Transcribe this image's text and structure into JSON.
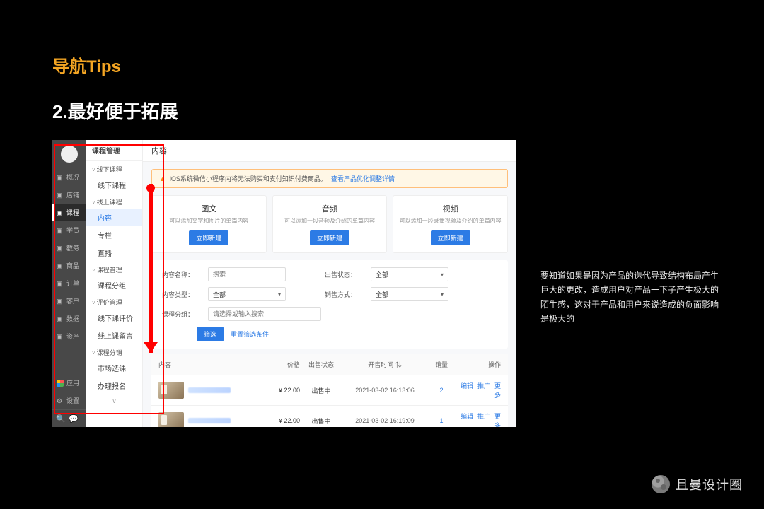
{
  "page": {
    "tips_label": "导航Tips",
    "heading": "2.最好便于拓展",
    "side_paragraph": "要知道如果是因为产品的迭代导致结构布局产生巨大的更改，造成用户对产品一下子产生极大的陌生感，这对于产品和用户来说造成的负面影响是极大的",
    "watermark": "且曼设计圈"
  },
  "rail": [
    {
      "icon": "overview",
      "label": "概况"
    },
    {
      "icon": "shop",
      "label": "店铺"
    },
    {
      "icon": "course",
      "label": "课程",
      "active": true
    },
    {
      "icon": "student",
      "label": "学员"
    },
    {
      "icon": "academic",
      "label": "教务"
    },
    {
      "icon": "goods",
      "label": "商品"
    },
    {
      "icon": "order",
      "label": "订单"
    },
    {
      "icon": "customer",
      "label": "客户"
    },
    {
      "icon": "data",
      "label": "数据"
    },
    {
      "icon": "asset",
      "label": "资产"
    }
  ],
  "rail_lower": [
    {
      "icon": "apps",
      "label": "应用"
    },
    {
      "icon": "settings",
      "label": "设置"
    }
  ],
  "subnav": {
    "title": "课程管理",
    "groups": [
      {
        "label": "线下课程",
        "items": [
          "线下课程"
        ]
      },
      {
        "label": "线上课程",
        "items": [
          "内容",
          "专栏",
          "直播"
        ],
        "active": "内容"
      },
      {
        "label": "课程管理",
        "items": [
          "课程分组"
        ]
      },
      {
        "label": "评价管理",
        "items": [
          "线下课评价",
          "线上课留言"
        ]
      },
      {
        "label": "课程分销",
        "items": [
          "市场选课"
        ]
      }
    ],
    "extra": "办理报名",
    "more": "∨"
  },
  "main": {
    "title": "内容",
    "alert": {
      "text": "iOS系统微信小程序内将无法购买和支付知识付费商品。",
      "link": "查看产品优化调整详情"
    },
    "cards": [
      {
        "title": "图文",
        "desc": "可以添加文字和图片的单篇内容",
        "btn": "立即新建"
      },
      {
        "title": "音频",
        "desc": "可以添加一段音频及介绍的单篇内容",
        "btn": "立即新建"
      },
      {
        "title": "视频",
        "desc": "可以添加一段录播视频及介绍的单篇内容",
        "btn": "立即新建"
      }
    ],
    "filters": {
      "name_label": "内容名称：",
      "name_placeholder": "搜索",
      "type_label": "内容类型：",
      "type_value": "全部",
      "status_label": "出售状态：",
      "status_value": "全部",
      "method_label": "销售方式：",
      "method_value": "全部",
      "group_label": "课程分组：",
      "group_placeholder": "请选择或输入搜索",
      "filter_btn": "筛选",
      "reset_link": "重置筛选条件"
    },
    "table": {
      "headers": {
        "content": "内容",
        "price": "价格",
        "status": "出售状态",
        "time": "开售时间 ⇅",
        "sales": "销量",
        "actions": "操作"
      },
      "rows": [
        {
          "price": "¥ 22.00",
          "status": "出售中",
          "time": "2021-03-02 16:13:06",
          "sales": "2"
        },
        {
          "price": "¥ 22.00",
          "status": "出售中",
          "time": "2021-03-02 16:19:09",
          "sales": "1"
        }
      ],
      "action_labels": {
        "edit": "编辑",
        "promote": "推广",
        "more": "更多"
      }
    }
  }
}
